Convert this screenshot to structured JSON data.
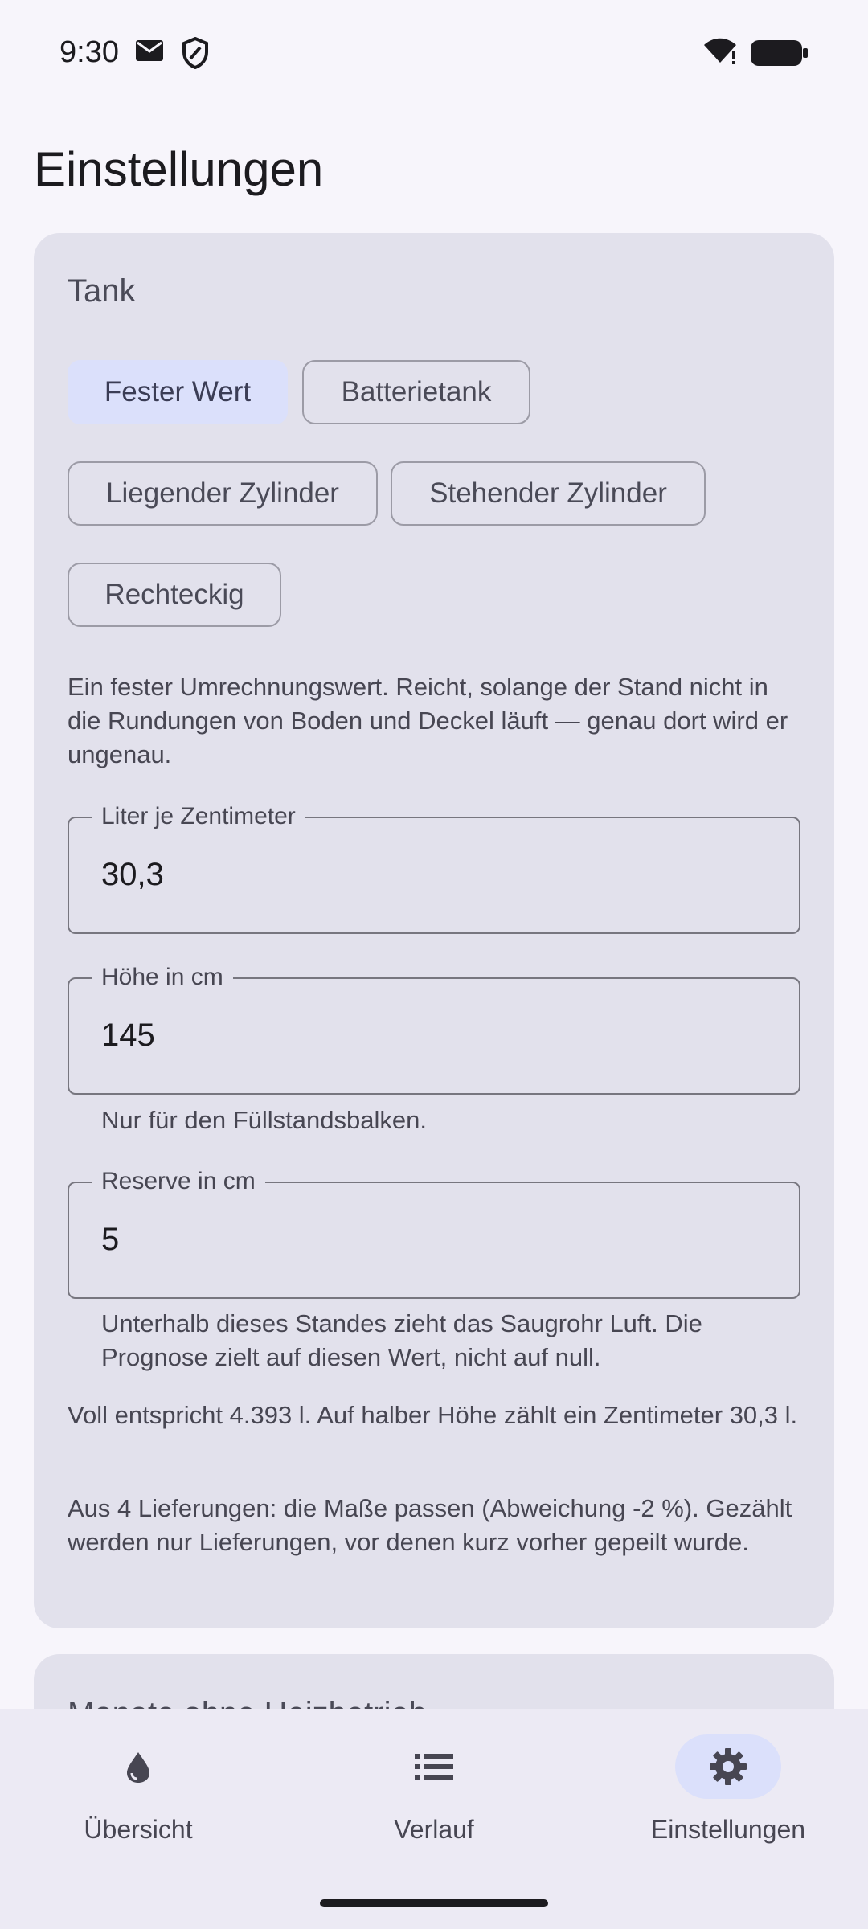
{
  "status_bar": {
    "time": "9:30",
    "icons": [
      "mail-icon",
      "shield-icon",
      "wifi-icon",
      "battery-icon"
    ]
  },
  "page": {
    "title": "Einstellungen"
  },
  "tank": {
    "title": "Tank",
    "options": [
      {
        "label": "Fester Wert",
        "selected": true
      },
      {
        "label": "Batterietank",
        "selected": false
      },
      {
        "label": "Liegender Zylinder",
        "selected": false
      },
      {
        "label": "Stehender Zylinder",
        "selected": false
      },
      {
        "label": "Rechteckig",
        "selected": false
      }
    ],
    "description": "Ein fester Umrechnungswert. Reicht, solange der Stand nicht in die Rundungen von Boden und Deckel läuft — genau dort wird er ungenau.",
    "liters_per_cm": {
      "label": "Liter je Zentimeter",
      "value": "30,3"
    },
    "height": {
      "label": "Höhe in cm",
      "value": "145",
      "helper": "Nur für den Füllstandsbalken."
    },
    "reserve": {
      "label": "Reserve in cm",
      "value": "5",
      "helper": "Unterhalb dieses Standes zieht das Saugrohr Luft. Die Prognose zielt auf diesen Wert, nicht auf null."
    },
    "full_info": "Voll entspricht 4.393 l. Auf halber Höhe zählt ein Zentimeter 30,3 l.",
    "deliveries_info": "Aus 4 Lieferungen: die Maße passen (Abweichung -2 %). Gezählt werden nur Lieferungen, vor denen kurz vorher gepeilt wurde."
  },
  "next_section": {
    "title": "Monate ohne Heizbetrieb"
  },
  "bottom_nav": {
    "items": [
      {
        "label": "Übersicht",
        "icon": "drop-icon",
        "active": false
      },
      {
        "label": "Verlauf",
        "icon": "list-icon",
        "active": false
      },
      {
        "label": "Einstellungen",
        "icon": "gear-icon",
        "active": true
      }
    ]
  },
  "colors": {
    "background": "#f7f5fb",
    "card": "#e2e1ec",
    "selected_chip": "#dbe0fb",
    "nav_bar": "#eceaf4",
    "text_primary": "#1c1b1f",
    "text_secondary": "#474652"
  }
}
